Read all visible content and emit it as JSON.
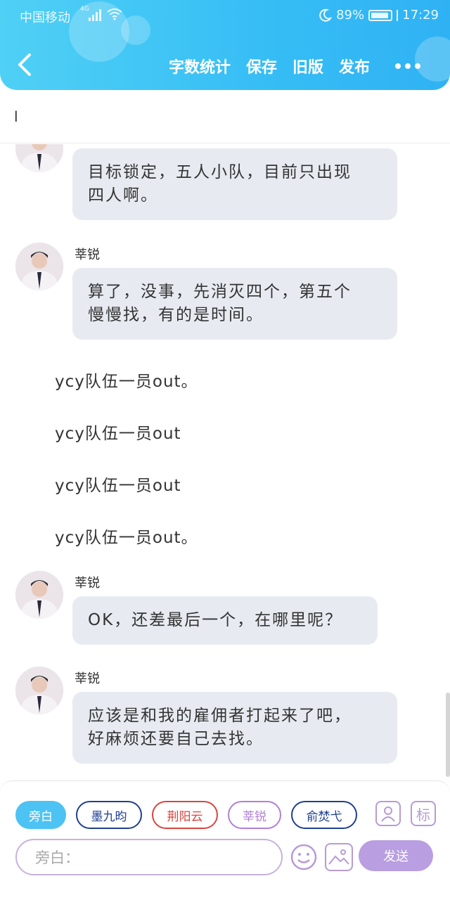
{
  "status_bar": {
    "carrier": "中国移动",
    "network": "4G",
    "battery": "89%",
    "time": "17:29"
  },
  "nav": {
    "actions": [
      "字数统计",
      "保存",
      "旧版",
      "发布"
    ]
  },
  "title": {
    "value": "l"
  },
  "messages": [
    {
      "type": "bubble",
      "speaker": "",
      "text_lines": [
        "目标锁定，五人小队，目前只出现",
        "四人啊。"
      ]
    },
    {
      "type": "bubble",
      "speaker": "莘锐",
      "text_lines": [
        "算了，没事，先消灭四个，第五个",
        "慢慢找，有的是时间。"
      ]
    },
    {
      "type": "narration",
      "text": "ycy队伍一员out。"
    },
    {
      "type": "narration",
      "text": "ycy队伍一员out"
    },
    {
      "type": "narration",
      "text": "ycy队伍一员out"
    },
    {
      "type": "narration",
      "text": "ycy队伍一员out。"
    },
    {
      "type": "bubble",
      "speaker": "莘锐",
      "text_lines": [
        "OK，还差最后一个，在哪里呢？"
      ]
    },
    {
      "type": "bubble",
      "speaker": "莘锐",
      "text_lines": [
        "应该是和我的雇佣者打起来了吧，",
        "好麻烦还要自己去找。"
      ]
    }
  ],
  "characters": [
    {
      "label": "旁白",
      "color": "#4cc3f3",
      "active": true
    },
    {
      "label": "墨九昀",
      "color": "#1f3f8f",
      "active": false
    },
    {
      "label": "荆阳云",
      "color": "#d9453d",
      "active": false
    },
    {
      "label": "莘锐",
      "color": "#b17fd6",
      "active": false
    },
    {
      "label": "俞焚弋",
      "color": "#1f3f8f",
      "active": false
    }
  ],
  "tools": {
    "profile_icon": "person-card-icon",
    "tag_label": "标"
  },
  "composer": {
    "placeholder": "旁白：",
    "send_label": "发送"
  },
  "colors": {
    "header_start": "#4fd0f5",
    "header_end": "#2fb2f3",
    "bubble_bg": "#e7ebf1",
    "accent_purple": "#b99ee1"
  }
}
